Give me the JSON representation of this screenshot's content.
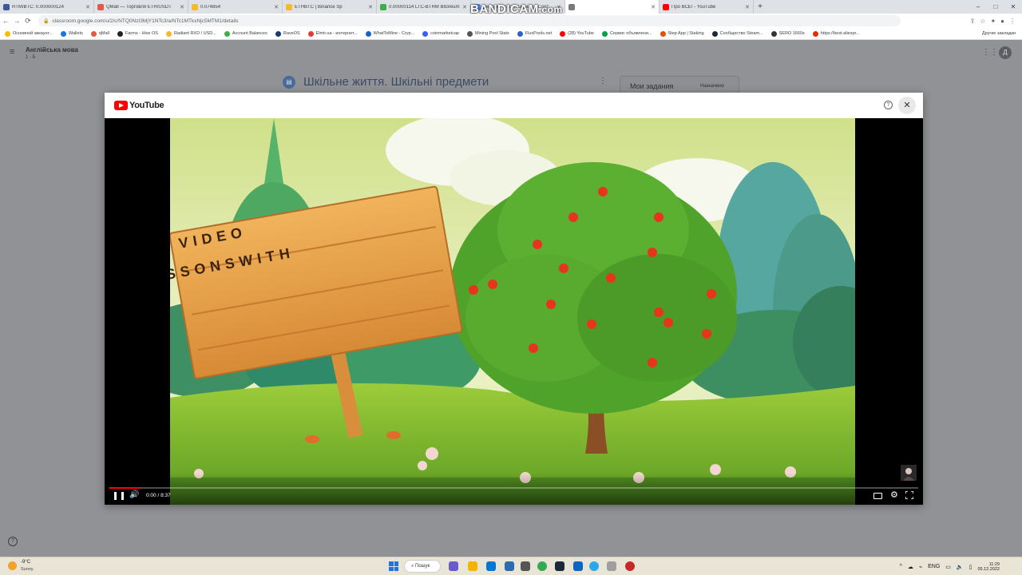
{
  "browser": {
    "tabs": [
      {
        "label": "RTM/BTC: 0.000000124",
        "color": "#3b5998"
      },
      {
        "label": "QMall — Торговля ETH/USDT",
        "color": "#e05a47"
      },
      {
        "label": "0.074854",
        "color": "#f3ba2f"
      },
      {
        "label": "ETHBTC | Binance Sp",
        "color": "#f3ba2f"
      },
      {
        "label": "0.00000114 LTC-BTRM Bitoreum",
        "color": "#3fae49"
      },
      {
        "label": "Депозит RXD (Radiant) - Сост",
        "color": "#4285f4"
      },
      {
        "label": "",
        "color": "#7a7a7a"
      },
      {
        "label": "Про ВСЕ! - YouTube",
        "color": "#ff0000"
      }
    ],
    "url": "classroom.google.com/u/2/c/NTQ0NzI3MjY1NTc3/a/NTc1MTkxNjc5MTM1/details",
    "bookmarks": [
      {
        "label": "Основной аккаунт...",
        "color": "#fbbc04"
      },
      {
        "label": "Wallets",
        "color": "#1a73e8"
      },
      {
        "label": "qMall",
        "color": "#e05a47"
      },
      {
        "label": "Farms - Hive OS",
        "color": "#222222"
      },
      {
        "label": "Radiant RXD / USD...",
        "color": "#f3ba2f"
      },
      {
        "label": "Account Balances",
        "color": "#3fae49"
      },
      {
        "label": "RaveOS",
        "color": "#1b3a6b"
      },
      {
        "label": "Elmir.ua - интернет...",
        "color": "#e53935"
      },
      {
        "label": "WhatToMine - Cryp...",
        "color": "#1565c0"
      },
      {
        "label": "coinmarketcap",
        "color": "#3861fb"
      },
      {
        "label": "Mining Pool Stats",
        "color": "#555555"
      },
      {
        "label": "FluxPools.net",
        "color": "#2b61d1"
      },
      {
        "label": "(28) YouTube",
        "color": "#ff0000"
      },
      {
        "label": "Сервис объявлени...",
        "color": "#00a046"
      },
      {
        "label": "Step App | Staking",
        "color": "#e65100"
      },
      {
        "label": "Сообщество Steam...",
        "color": "#1b2838"
      },
      {
        "label": "SERO 1660s",
        "color": "#333333"
      },
      {
        "label": "https://best.aliexpr...",
        "color": "#e62e04"
      }
    ],
    "other_bookmarks": "Другие закладки"
  },
  "classroom": {
    "course_title": "Англійська мова",
    "course_section": "1 - Б",
    "avatar_letter": "Д",
    "assignment_title": "Шкільне життя. Шкільні предмети",
    "my_tasks_label": "Мои задания",
    "my_tasks_status": "Назначено"
  },
  "youtube": {
    "logo_text": "YouTube",
    "sign_text_line1": "VIDEO",
    "sign_text_line2": "SSONSWITH",
    "time_display": "0:00 / 8:37",
    "progress_fraction": 0.038
  },
  "watermark": {
    "brand": "BANDICAM",
    "suffix": ".com"
  },
  "taskbar": {
    "weather_temp": "-9°C",
    "weather_desc": "Sunny",
    "search_label": "Пошук",
    "language": "ENG",
    "time": "11:29",
    "date": "05.12.2022"
  }
}
